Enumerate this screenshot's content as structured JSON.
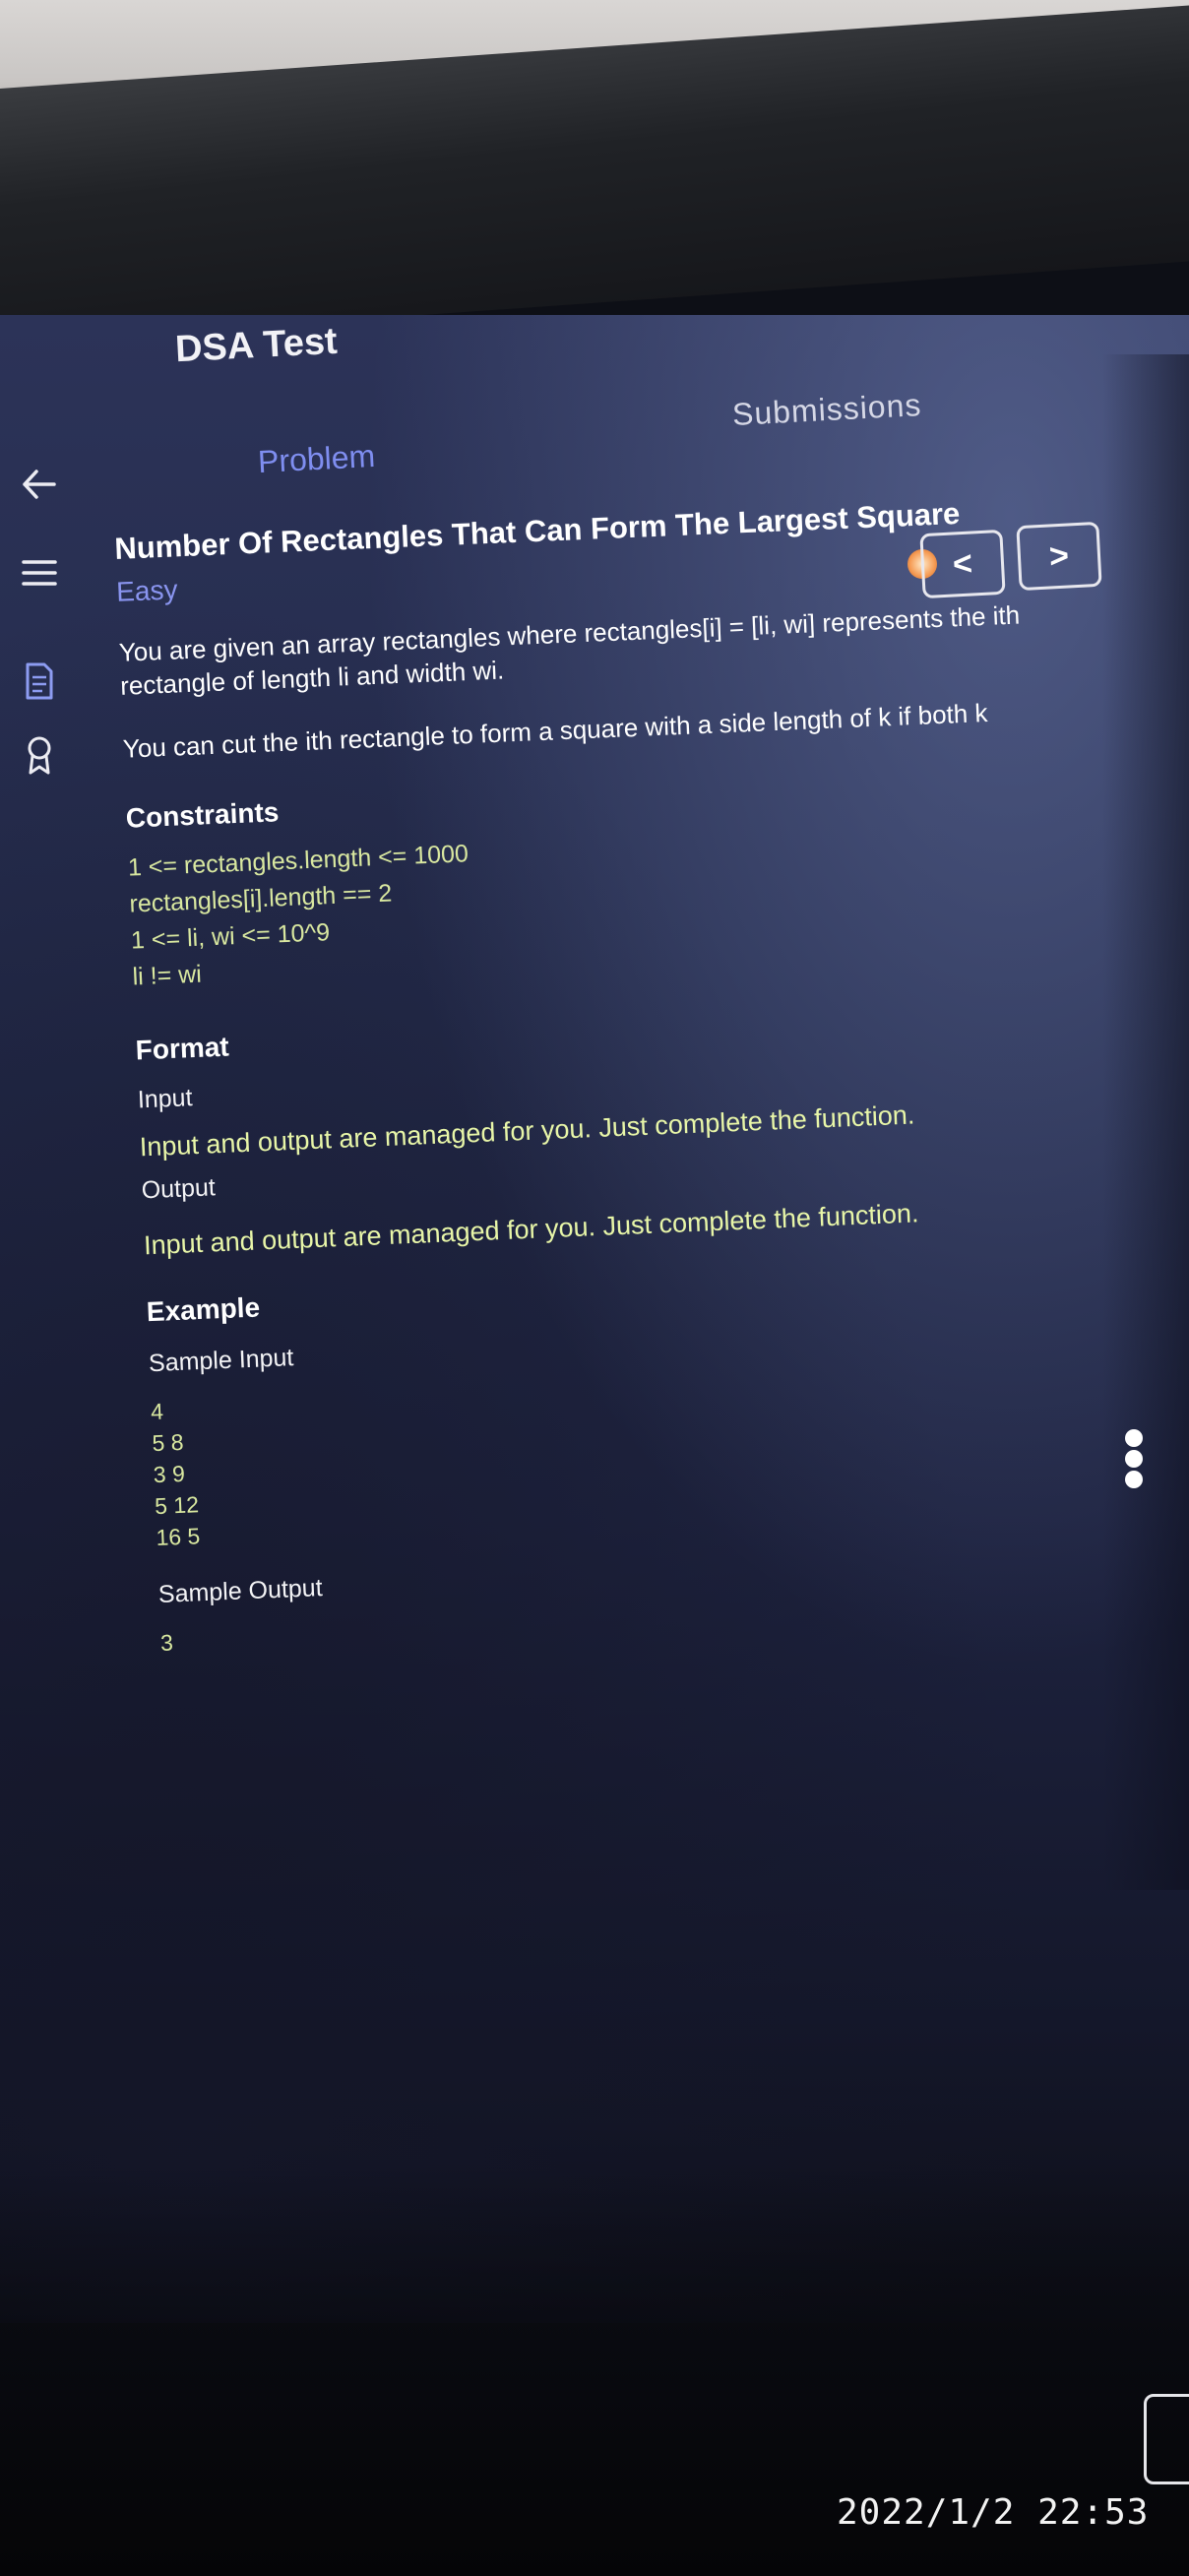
{
  "header": {
    "app_title": "DSA Test",
    "tabs": [
      "Problem",
      "Submissions"
    ]
  },
  "sidebar": {
    "icons": [
      "back-arrow-icon",
      "menu-icon",
      "document-icon",
      "award-icon"
    ]
  },
  "problem": {
    "title": "Number Of Rectangles That Can Form The Largest Square",
    "difficulty": "Easy",
    "description": [
      "You are given an array rectangles where rectangles[i] = [li, wi] represents the ith rectangle of length li and width wi.",
      "You can cut the ith rectangle to form a square with a side length of k if both k"
    ],
    "constraints_heading": "Constraints",
    "constraints": [
      "1 <= rectangles.length <= 1000",
      "rectangles[i].length == 2",
      "1 <= li, wi <= 10^9",
      "li != wi"
    ],
    "format_heading": "Format",
    "input_label": "Input",
    "input_text": "Input and output are managed for you. Just complete the function.",
    "output_label": "Output",
    "output_text": "Input and output are managed for you. Just complete the function.",
    "example_heading": "Example",
    "sample_input_label": "Sample Input",
    "sample_input": [
      "4",
      "5 8",
      "3 9",
      "5 12",
      "16 5"
    ],
    "sample_output_label": "Sample Output",
    "sample_output": "3"
  },
  "nav": {
    "prev_symbol": "<",
    "next_symbol": ">"
  },
  "timestamp": "2022/1/2 22:53"
}
